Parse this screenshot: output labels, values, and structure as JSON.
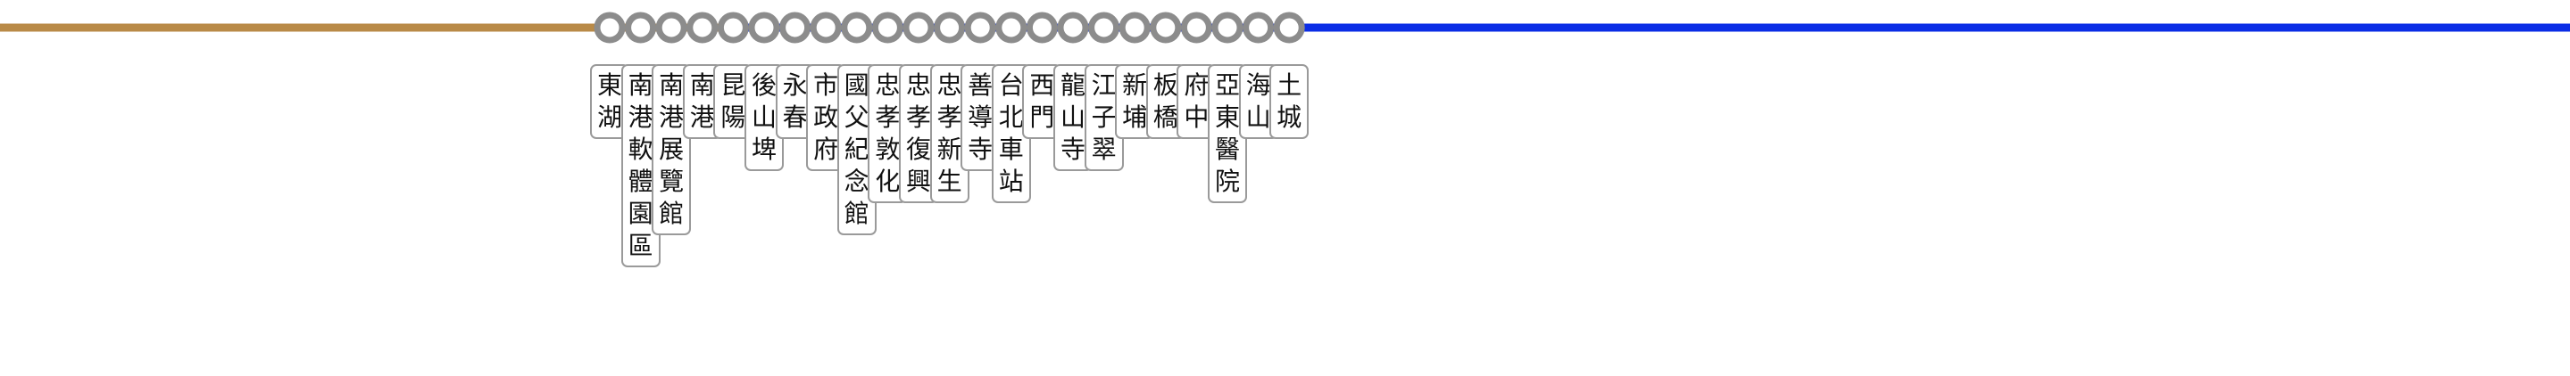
{
  "colors": {
    "brown_segment": "#b98a47",
    "blue_segment": "#0b2de6",
    "station_ring": "#8c8c8c",
    "station_fill": "#ffffff",
    "label_border": "#9a9a9a"
  },
  "stations": [
    {
      "name": "東湖",
      "line": "brown"
    },
    {
      "name": "南港軟體園區",
      "line": "brown"
    },
    {
      "name": "南港展覽館",
      "line": "shared"
    },
    {
      "name": "南港",
      "line": "blue"
    },
    {
      "name": "昆陽",
      "line": "blue"
    },
    {
      "name": "後山埤",
      "line": "blue"
    },
    {
      "name": "永春",
      "line": "blue"
    },
    {
      "name": "市政府",
      "line": "blue"
    },
    {
      "name": "國父紀念館",
      "line": "blue"
    },
    {
      "name": "忠孝敦化",
      "line": "blue"
    },
    {
      "name": "忠孝復興",
      "line": "blue"
    },
    {
      "name": "忠孝新生",
      "line": "blue"
    },
    {
      "name": "善導寺",
      "line": "blue"
    },
    {
      "name": "台北車站",
      "line": "blue"
    },
    {
      "name": "西門",
      "line": "blue"
    },
    {
      "name": "龍山寺",
      "line": "blue"
    },
    {
      "name": "江子翠",
      "line": "blue"
    },
    {
      "name": "新埔",
      "line": "blue"
    },
    {
      "name": "板橋",
      "line": "blue"
    },
    {
      "name": "府中",
      "line": "blue"
    },
    {
      "name": "亞東醫院",
      "line": "blue"
    },
    {
      "name": "海山",
      "line": "blue"
    },
    {
      "name": "土城",
      "line": "blue"
    }
  ]
}
